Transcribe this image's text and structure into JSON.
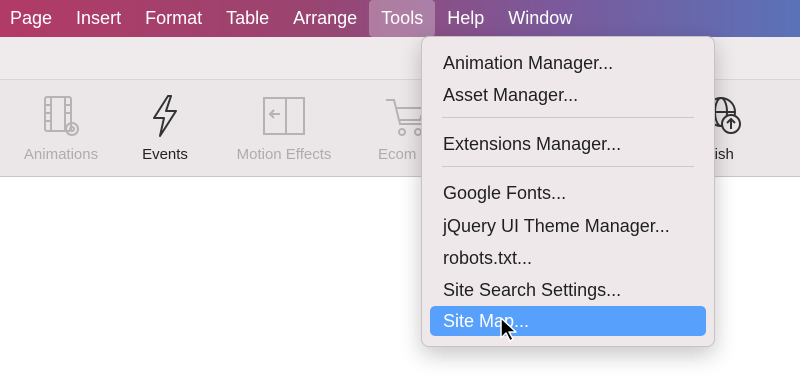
{
  "menubar": {
    "items": [
      "Page",
      "Insert",
      "Format",
      "Table",
      "Arrange",
      "Tools",
      "Help",
      "Window"
    ],
    "active": "Tools"
  },
  "toolbar": {
    "items": [
      {
        "label": "Animations",
        "icon": "film-gear-icon",
        "enabled": false
      },
      {
        "label": "Events",
        "icon": "lightning-icon",
        "enabled": true
      },
      {
        "label": "Motion Effects",
        "icon": "motion-effects-icon",
        "enabled": false
      },
      {
        "label": "Ecom",
        "icon": "cart-icon",
        "enabled": false
      },
      {
        "label": "blish",
        "icon": "globe-upload-icon",
        "enabled": true
      }
    ]
  },
  "tools_menu": {
    "groups": [
      [
        "Animation Manager...",
        "Asset Manager..."
      ],
      [
        "Extensions Manager..."
      ],
      [
        "Google Fonts...",
        "jQuery UI Theme Manager...",
        "robots.txt...",
        "Site Search Settings...",
        "Site Map..."
      ]
    ],
    "highlighted": "Site Map..."
  },
  "colors": {
    "highlight": "#57a0fb",
    "menubar_start": "#b23a66",
    "menubar_end": "#5a72b8"
  }
}
